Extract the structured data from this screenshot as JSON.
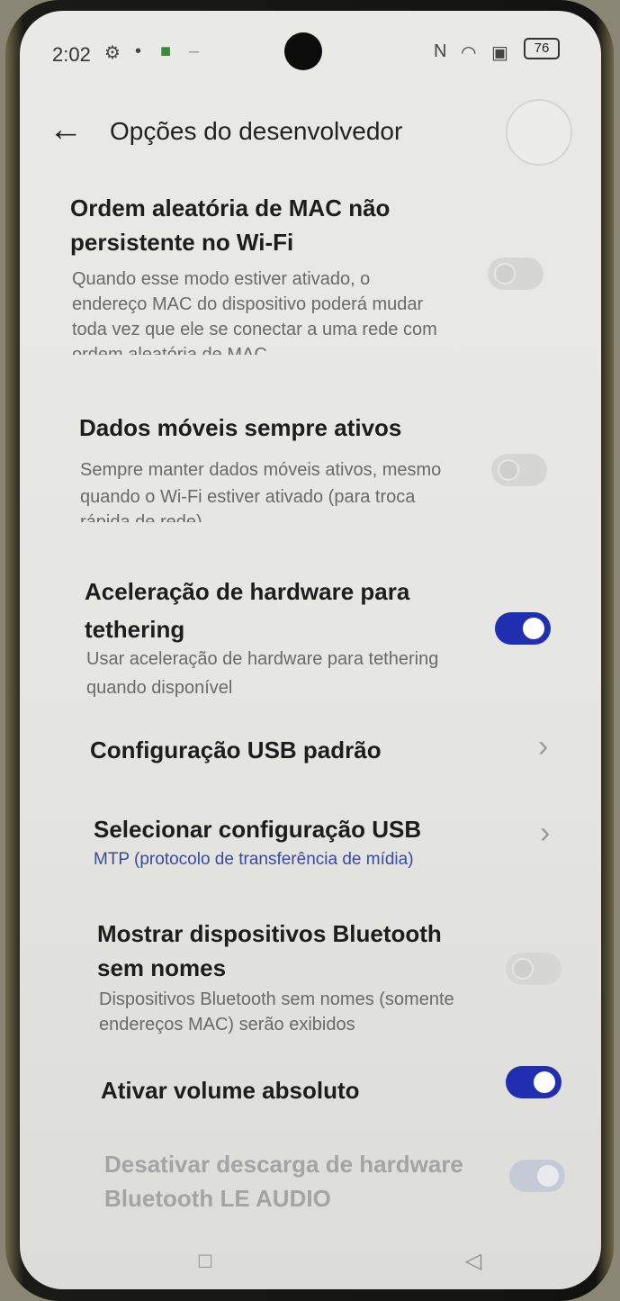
{
  "status": {
    "time": "2:02",
    "battery": "76",
    "icons": [
      "settings-icon",
      "bug-icon",
      "app-icon",
      "nfc-icon",
      "wifi-icon",
      "mobile-data-icon"
    ]
  },
  "header": {
    "back_icon": "arrow-left-icon",
    "title": "Opções do desenvolvedor"
  },
  "settings": [
    {
      "title_line1": "Ordem aleatória de MAC não",
      "title_line2": "persistente no Wi-Fi",
      "desc_line1": "Quando esse modo estiver ativado, o",
      "desc_line2": "endereço MAC do dispositivo poderá mudar",
      "desc_line3": "toda vez que ele se conectar a uma rede com",
      "desc_line4": "ordem aleatória de MAC",
      "toggle": "off"
    },
    {
      "title": "Dados móveis sempre ativos",
      "desc_line1": "Sempre manter dados móveis ativos, mesmo",
      "desc_line2": "quando o Wi-Fi estiver ativado (para troca",
      "desc_line3": "rápida de rede)",
      "toggle": "off"
    },
    {
      "title_line1": "Aceleração de hardware para",
      "title_line2": "tethering",
      "desc_line1": "Usar aceleração de hardware para tethering",
      "desc_line2": "quando disponível",
      "toggle": "on"
    },
    {
      "title": "Configuração USB padrão",
      "chevron": "chevron-right-icon"
    },
    {
      "title": "Selecionar configuração USB",
      "subtitle": "MTP (protocolo de transferência de mídia)",
      "chevron": "chevron-right-icon"
    },
    {
      "title_line1": "Mostrar dispositivos Bluetooth",
      "title_line2": "sem nomes",
      "desc_line1": "Dispositivos Bluetooth sem nomes (somente",
      "desc_line2": "endereços MAC) serão exibidos",
      "toggle": "off"
    },
    {
      "title": "Ativar volume absoluto",
      "toggle": "on"
    },
    {
      "title_line1": "Desativar descarga de hardware",
      "title_line2": "Bluetooth LE AUDIO",
      "toggle": "on",
      "disabled": true
    }
  ],
  "colors": {
    "accent": "#1f2fb0",
    "subtitle": "#3b4a9a",
    "text": "#1d1d1d",
    "muted": "#6a6a6a"
  }
}
